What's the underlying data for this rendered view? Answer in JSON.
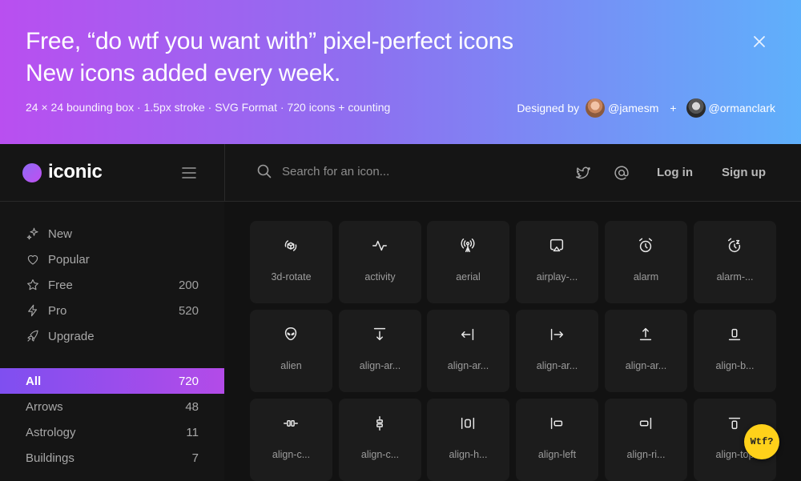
{
  "banner": {
    "headline_line1": "Free, “do wtf you want with” pixel-perfect icons",
    "headline_line2": "New icons added every week.",
    "subline": "24 × 24 bounding box · 1.5px stroke · SVG Format · 720 icons + counting",
    "designed_by": "Designed by",
    "designer1": "@jamesm",
    "plus": "+",
    "designer2": "@ormanclark"
  },
  "header": {
    "logo": "iconic",
    "search_placeholder": "Search for an icon...",
    "login": "Log in",
    "signup": "Sign up"
  },
  "nav": [
    {
      "label": "New",
      "count": ""
    },
    {
      "label": "Popular",
      "count": ""
    },
    {
      "label": "Free",
      "count": "200"
    },
    {
      "label": "Pro",
      "count": "520"
    },
    {
      "label": "Upgrade",
      "count": ""
    }
  ],
  "categories": [
    {
      "label": "All",
      "count": "720",
      "active": true
    },
    {
      "label": "Arrows",
      "count": "48"
    },
    {
      "label": "Astrology",
      "count": "11"
    },
    {
      "label": "Buildings",
      "count": "7"
    }
  ],
  "icons": [
    {
      "label": "3d-rotate",
      "icon": "3d-rotate-icon"
    },
    {
      "label": "activity",
      "icon": "activity-icon"
    },
    {
      "label": "aerial",
      "icon": "aerial-icon"
    },
    {
      "label": "airplay-...",
      "icon": "airplay-icon"
    },
    {
      "label": "alarm",
      "icon": "alarm-icon"
    },
    {
      "label": "alarm-...",
      "icon": "alarm-snooze-icon"
    },
    {
      "label": "alien",
      "icon": "alien-icon"
    },
    {
      "label": "align-ar...",
      "icon": "align-arrow-bottom-icon"
    },
    {
      "label": "align-ar...",
      "icon": "align-arrow-left-icon"
    },
    {
      "label": "align-ar...",
      "icon": "align-arrow-right-icon"
    },
    {
      "label": "align-ar...",
      "icon": "align-arrow-top-icon"
    },
    {
      "label": "align-b...",
      "icon": "align-bottom-icon"
    },
    {
      "label": "align-c...",
      "icon": "align-center-horizontal-icon"
    },
    {
      "label": "align-c...",
      "icon": "align-center-vertical-icon"
    },
    {
      "label": "align-h...",
      "icon": "align-horizontal-icon"
    },
    {
      "label": "align-left",
      "icon": "align-left-icon"
    },
    {
      "label": "align-ri...",
      "icon": "align-right-icon"
    },
    {
      "label": "align-top",
      "icon": "align-top-icon"
    }
  ],
  "wtf_button": "Wtf?",
  "colors": {
    "banner_start": "#b94ff0",
    "banner_end": "#5fb0fb",
    "accent": "#9a4df0",
    "wtf": "#ffd11a",
    "background": "#121212"
  }
}
